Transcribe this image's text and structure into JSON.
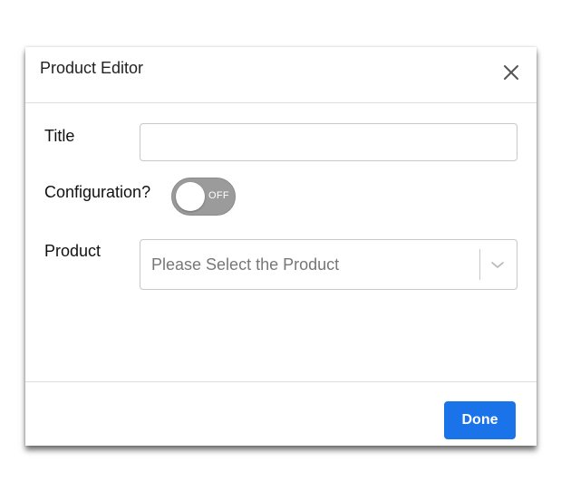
{
  "dialog": {
    "title": "Product Editor",
    "close_icon": "close-icon"
  },
  "form": {
    "title_label": "Title",
    "title_value": "",
    "title_placeholder": "",
    "configuration_label": "Configuration?",
    "configuration_toggle": {
      "state": "OFF",
      "on": false
    },
    "product_label": "Product",
    "product_select": {
      "placeholder": "Please Select the Product",
      "selected": "",
      "icon": "chevron-down-icon"
    }
  },
  "footer": {
    "done_label": "Done"
  },
  "colors": {
    "primary_button": "#1a73e8",
    "toggle_off": "#9b9b9b",
    "border": "#c8c8c8"
  }
}
